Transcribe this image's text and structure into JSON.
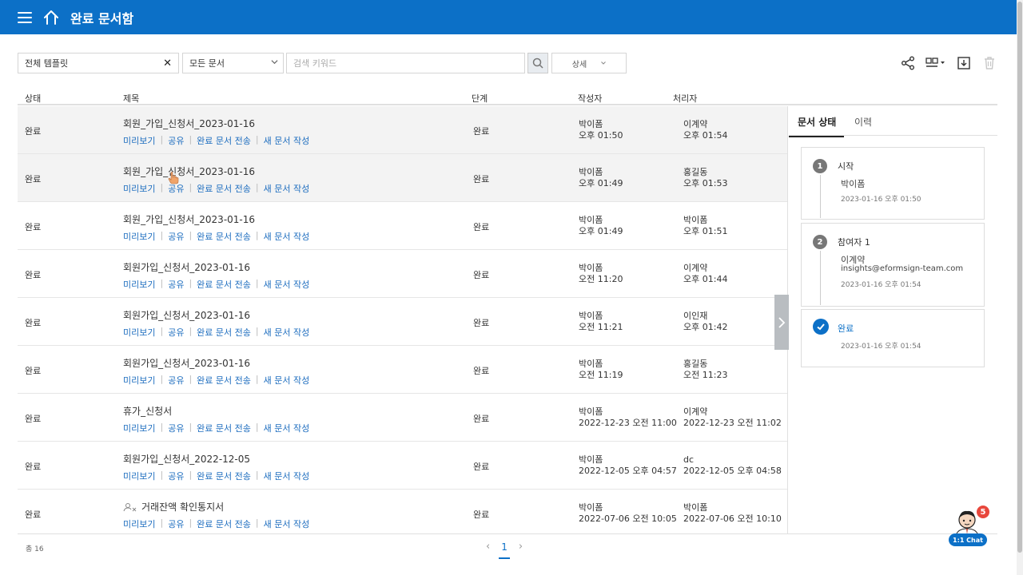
{
  "header": {
    "title": "완료 문서함"
  },
  "filters": {
    "template": "전체 템플릿",
    "clear_icon": "✕",
    "doc_type": "모든 문서",
    "search_placeholder": "검색 키워드",
    "detail": "상세"
  },
  "columns": {
    "status": "상태",
    "title": "제목",
    "stage": "단계",
    "author": "작성자",
    "handler": "처리자"
  },
  "row_links": [
    "미리보기",
    "공유",
    "완료 문서 전송",
    "새 문서 작성"
  ],
  "rows": [
    {
      "status": "완료",
      "title": "회원_가입_신청서_2023-01-16",
      "stage": "완료",
      "author": "박이폼",
      "author_time": "오후 01:50",
      "handler": "이계약",
      "handler_time": "오후 01:54",
      "selected": true
    },
    {
      "status": "완료",
      "title": "회원_가입_신청서_2023-01-16",
      "stage": "완료",
      "author": "박이폼",
      "author_time": "오후 01:49",
      "handler": "홍길동",
      "handler_time": "오후 01:53",
      "selected": true
    },
    {
      "status": "완료",
      "title": "회원_가입_신청서_2023-01-16",
      "stage": "완료",
      "author": "박이폼",
      "author_time": "오후 01:49",
      "handler": "박이폼",
      "handler_time": "오후 01:51",
      "selected": false
    },
    {
      "status": "완료",
      "title": "회원가입_신청서_2023-01-16",
      "stage": "완료",
      "author": "박이폼",
      "author_time": "오전 11:20",
      "handler": "이계약",
      "handler_time": "오후 01:44",
      "selected": false
    },
    {
      "status": "완료",
      "title": "회원가입_신청서_2023-01-16",
      "stage": "완료",
      "author": "박이폼",
      "author_time": "오전 11:21",
      "handler": "이인재",
      "handler_time": "오후 01:42",
      "selected": false
    },
    {
      "status": "완료",
      "title": "회원가입_신청서_2023-01-16",
      "stage": "완료",
      "author": "박이폼",
      "author_time": "오전 11:19",
      "handler": "홍길동",
      "handler_time": "오전 11:23",
      "selected": false
    },
    {
      "status": "완료",
      "title": "휴가_신청서",
      "stage": "완료",
      "author": "박이폼",
      "author_time": "2022-12-23 오전 11:00",
      "handler": "이계약",
      "handler_time": "2022-12-23 오전 11:02",
      "selected": false
    },
    {
      "status": "완료",
      "title": "회원가입_신청서_2022-12-05",
      "stage": "완료",
      "author": "박이폼",
      "author_time": "2022-12-05 오후 04:57",
      "handler": "dc",
      "handler_time": "2022-12-05 오후 04:58",
      "selected": false
    },
    {
      "status": "완료",
      "title": "거래잔액 확인통지서",
      "stage": "완료",
      "author": "박이폼",
      "author_time": "2022-07-06 오전 10:05",
      "handler": "박이폼",
      "handler_time": "2022-07-06 오전 10:10",
      "selected": false,
      "has_icon": true
    }
  ],
  "panel": {
    "tab_status": "문서 상태",
    "tab_history": "이력",
    "steps": [
      {
        "num": "1",
        "label": "시작",
        "who": "박이폼",
        "time": "2023-01-16 오후 01:50"
      },
      {
        "num": "2",
        "label": "참여자 1",
        "who": "이계약",
        "email": "insights@eformsign-team.com",
        "time": "2023-01-16 오후 01:54"
      },
      {
        "label": "완료",
        "time": "2023-01-16 오후 01:54"
      }
    ]
  },
  "footer": {
    "total": "총 16",
    "page": "1"
  },
  "chat": {
    "label": "1:1 Chat",
    "badge": "5"
  },
  "colors": {
    "brand": "#0c70c7",
    "link": "#1d6dbf",
    "badge": "#e8473c"
  }
}
